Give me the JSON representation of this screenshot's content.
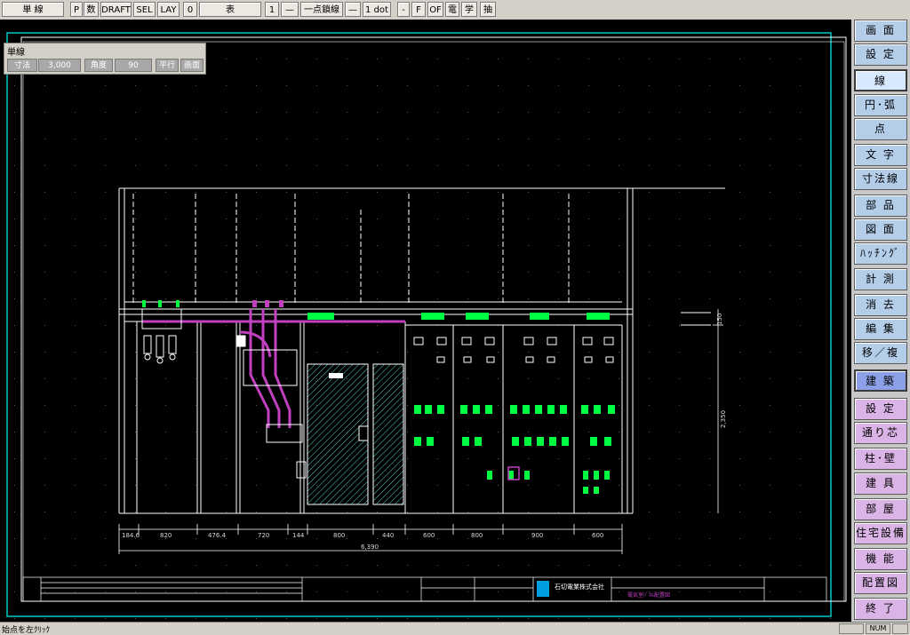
{
  "toolbar": {
    "mode": "単 線",
    "p": "P",
    "num": "数",
    "draft": "DRAFT",
    "sel": "SEL",
    "lay": "LAY",
    "layer_no": "0",
    "table": "表",
    "line_no": "1",
    "line_dash1": "—",
    "linetype": "一点鎖線",
    "line_dash2": "—",
    "dot": "1 dot",
    "minus": "-",
    "f": "F",
    "of": "OF",
    "den": "電",
    "gaku": "学",
    "chu": "抽"
  },
  "prop_box": {
    "title": "単線",
    "dim_label": "寸法",
    "dim_value": "3,000",
    "angle_label": "角度",
    "angle_value": "90",
    "parallel": "平行",
    "screen": "画面"
  },
  "sidebar": {
    "items": [
      {
        "label": "画 面",
        "color": "blue"
      },
      {
        "label": "設 定",
        "color": "blue"
      },
      {
        "label": "線",
        "color": "blue",
        "active": true
      },
      {
        "label": "円･弧",
        "color": "blue"
      },
      {
        "label": "点",
        "color": "blue"
      },
      {
        "label": "文 字",
        "color": "blue"
      },
      {
        "label": "寸法線",
        "color": "blue"
      },
      {
        "label": "部 品",
        "color": "blue"
      },
      {
        "label": "図 面",
        "color": "blue"
      },
      {
        "label": "ﾊｯﾁﾝｸﾞ",
        "color": "blue"
      },
      {
        "label": "計 測",
        "color": "blue"
      },
      {
        "label": "消 去",
        "color": "blue"
      },
      {
        "label": "編 集",
        "color": "blue"
      },
      {
        "label": "移／複",
        "color": "blue"
      },
      {
        "label": "建 築",
        "color": "pink",
        "active": true
      },
      {
        "label": "設 定",
        "color": "pink"
      },
      {
        "label": "通り芯",
        "color": "pink"
      },
      {
        "label": "柱･壁",
        "color": "pink"
      },
      {
        "label": "建 具",
        "color": "pink"
      },
      {
        "label": "部 屋",
        "color": "pink"
      },
      {
        "label": "住宅設備",
        "color": "pink"
      },
      {
        "label": "機 能",
        "color": "pink"
      },
      {
        "label": "配置図",
        "color": "pink"
      },
      {
        "label": "終 了",
        "color": "pink"
      }
    ]
  },
  "drawing": {
    "dims": [
      "184.6",
      "820",
      "476.4",
      "720",
      "144",
      "800",
      "440",
      "600",
      "800",
      "900",
      "600"
    ],
    "total_dim": "6,390",
    "height_dim_1": "150",
    "height_dim_2": "2,350",
    "company": "石切電業株式会社",
    "title_block_label": "電気室ﾊﾟﾈﾙ配置図"
  },
  "status": {
    "text": "始点を左ｸﾘｯｸ",
    "num": "NUM"
  },
  "colors": {
    "canvas_bg": "#000000",
    "frame": "#00c8c8",
    "drawing_line": "#ffffff",
    "cable": "#c040c0",
    "breaker": "#00ff40",
    "hatch": "#50d0c8",
    "sidebar_blue": "#b4cde9",
    "sidebar_pink": "#dab4e6"
  }
}
